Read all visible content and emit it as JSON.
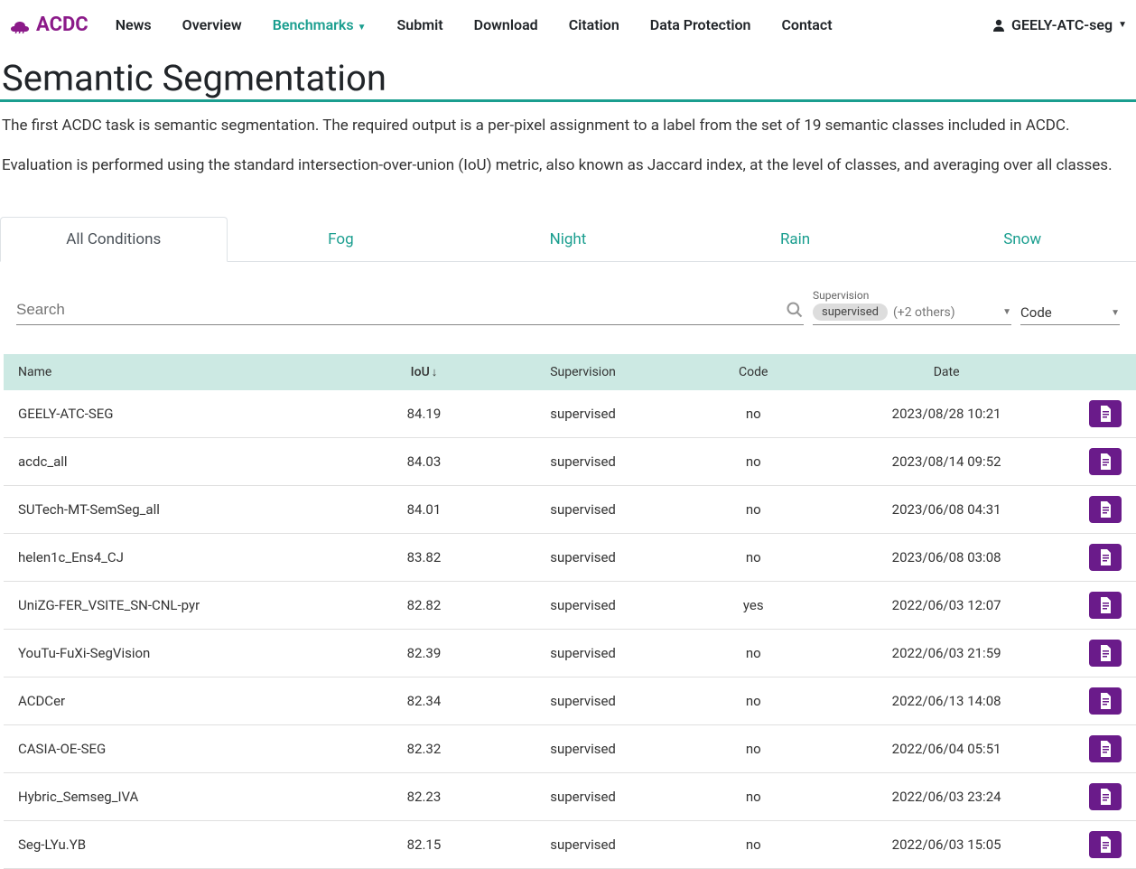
{
  "brand": "ACDC",
  "nav": {
    "items": [
      "News",
      "Overview",
      "Benchmarks",
      "Submit",
      "Download",
      "Citation",
      "Data Protection",
      "Contact"
    ],
    "active_index": 2,
    "user": "GEELY-ATC-seg"
  },
  "page": {
    "title": "Semantic Segmentation",
    "desc1": "The first ACDC task is semantic segmentation. The required output is a per-pixel assignment to a label from the set of 19 semantic classes included in ACDC.",
    "desc2": "Evaluation is performed using the standard intersection-over-union (IoU) metric, also known as Jaccard index, at the level of classes, and averaging over all classes."
  },
  "tabs": [
    "All Conditions",
    "Fog",
    "Night",
    "Rain",
    "Snow"
  ],
  "active_tab": 0,
  "filters": {
    "search_placeholder": "Search",
    "supervision_label": "Supervision",
    "supervision_chip": "supervised",
    "supervision_others": "(+2 others)",
    "code_label": "Code"
  },
  "table": {
    "headers": {
      "name": "Name",
      "iou": "IoU",
      "supervision": "Supervision",
      "code": "Code",
      "date": "Date"
    },
    "rows": [
      {
        "name": "GEELY-ATC-SEG",
        "iou": "84.19",
        "supervision": "supervised",
        "code": "no",
        "date": "2023/08/28 10:21"
      },
      {
        "name": "acdc_all",
        "iou": "84.03",
        "supervision": "supervised",
        "code": "no",
        "date": "2023/08/14 09:52"
      },
      {
        "name": "SUTech-MT-SemSeg_all",
        "iou": "84.01",
        "supervision": "supervised",
        "code": "no",
        "date": "2023/06/08 04:31"
      },
      {
        "name": "helen1c_Ens4_CJ",
        "iou": "83.82",
        "supervision": "supervised",
        "code": "no",
        "date": "2023/06/08 03:08"
      },
      {
        "name": "UniZG-FER_VSITE_SN-CNL-pyr",
        "iou": "82.82",
        "supervision": "supervised",
        "code": "yes",
        "date": "2022/06/03 12:07"
      },
      {
        "name": "YouTu-FuXi-SegVision",
        "iou": "82.39",
        "supervision": "supervised",
        "code": "no",
        "date": "2022/06/03 21:59"
      },
      {
        "name": "ACDCer",
        "iou": "82.34",
        "supervision": "supervised",
        "code": "no",
        "date": "2022/06/13 14:08"
      },
      {
        "name": "CASIA-OE-SEG",
        "iou": "82.32",
        "supervision": "supervised",
        "code": "no",
        "date": "2022/06/04 05:51"
      },
      {
        "name": "Hybric_Semseg_IVA",
        "iou": "82.23",
        "supervision": "supervised",
        "code": "no",
        "date": "2022/06/03 23:24"
      },
      {
        "name": "Seg-LYu.YB",
        "iou": "82.15",
        "supervision": "supervised",
        "code": "no",
        "date": "2022/06/03 15:05"
      }
    ]
  }
}
